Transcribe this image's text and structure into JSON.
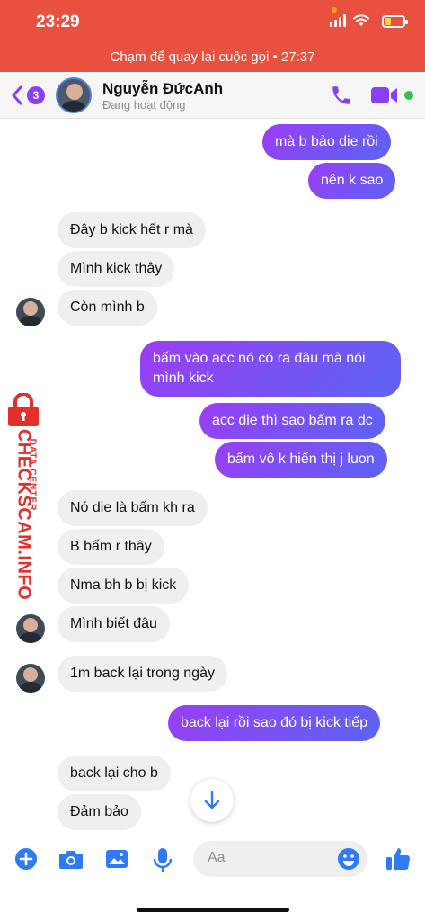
{
  "status_bar": {
    "time": "23:29",
    "call_banner": "Chạm để quay lại cuộc gọi • 27:37",
    "battery_percent": 35
  },
  "header": {
    "back_badge": "3",
    "contact_name": "Nguyễn ĐứcAnh",
    "contact_status": "Đang hoạt động",
    "online": true,
    "icons": [
      "back-chevron-icon",
      "phone-icon",
      "video-icon"
    ]
  },
  "conversation": {
    "outgoing_gradient": [
      "#9b3df5",
      "#5b64f4"
    ],
    "messages": [
      {
        "direction": "out",
        "text": "mà b bảo die rồi"
      },
      {
        "direction": "out",
        "text": "nên k sao"
      },
      {
        "direction": "in",
        "text": "Đây b kick hết r mà"
      },
      {
        "direction": "in",
        "text": "Mình kick thây"
      },
      {
        "direction": "in",
        "text": "Còn mình b"
      },
      {
        "direction": "out",
        "text": "bấm vào acc nó có ra đâu mà nói"
      },
      {
        "direction": "out",
        "text": "mình kick"
      },
      {
        "direction": "out",
        "text": "acc die thì sao bấm ra dc"
      },
      {
        "direction": "out",
        "text": "bấm vô k hiển thị j luon"
      },
      {
        "direction": "in",
        "text": "Nó die là bấm kh ra"
      },
      {
        "direction": "in",
        "text": "B bấm r thây"
      },
      {
        "direction": "in",
        "text": "Nma bh b bị kick"
      },
      {
        "direction": "in",
        "text": "Mình biết đâu"
      },
      {
        "direction": "in",
        "text": "1m back lại trong ngày"
      },
      {
        "direction": "out",
        "text": "back lại rồi sao đó bị kick tiếp"
      },
      {
        "direction": "in",
        "text": "back lại cho b"
      },
      {
        "direction": "in",
        "text": "Đảm bảo"
      }
    ]
  },
  "watermark": {
    "main": "CHECKSCAM.INFO",
    "sub": "DATA CENTER",
    "color": "#e0312b"
  },
  "composer": {
    "placeholder": "Aa",
    "icons": [
      "plus-icon",
      "camera-icon",
      "image-icon",
      "microphone-icon",
      "emoji-icon",
      "thumbs-up-icon"
    ]
  },
  "colors": {
    "call_banner": "#e8503f",
    "accent": "#8a3ff5",
    "incoming_bubble": "#efeff1"
  }
}
